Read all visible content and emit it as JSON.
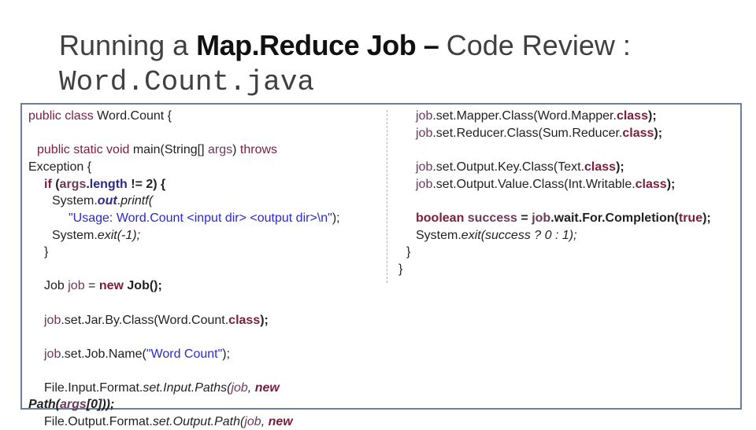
{
  "slide": {
    "title_prefix": "Running a ",
    "title_bold": "Map.Reduce Job",
    "title_dash": " – ",
    "title_suffix": "Code Review :",
    "title_line2": "Word.Count.java"
  },
  "left": {
    "l1_a": "public class ",
    "l1_b": "Word.Count {",
    "l2_a": "public static void ",
    "l2_b": "main(String[] ",
    "l2_c": "args",
    "l2_d": ") ",
    "l2_e": "throws",
    "l3": "Exception {",
    "l4_a": "if ",
    "l4_b": "(",
    "l4_c": "args",
    "l4_d": ".",
    "l4_e": "length",
    "l4_f": " != 2) {",
    "l5_a": "System.",
    "l5_b": "out",
    "l5_c": ".",
    "l5_d": "printf(",
    "l6_a": "\"Usage: Word.Count <input dir> <output dir>\\n\"",
    "l6_b": ");",
    "l7_a": "System.",
    "l7_b": "exit(-1);",
    "l8": "}",
    "l9_a": "Job ",
    "l9_b": "job",
    "l9_c": " = ",
    "l9_d": "new ",
    "l9_e": "Job();",
    "l10_a": "job",
    "l10_b": ".set.Jar.By.Class(Word.Count.",
    "l10_c": "class",
    "l10_d": ");",
    "l11_a": "job",
    "l11_b": ".set.Job.Name(",
    "l11_c": "\"Word Count\"",
    "l11_d": ");",
    "l12_a": "File.Input.Format.",
    "l12_b": "set.Input.Paths(",
    "l12_c": "job",
    "l12_d": ", ",
    "l12_e": "new",
    "l13_a": "Path(",
    "l13_b": "args",
    "l13_c": "[0]));",
    "l14_a": "File.Output.Format.",
    "l14_b": "set.Output.Path(",
    "l14_c": "job",
    "l14_d": ", ",
    "l14_e": "new"
  },
  "right": {
    "r1_a": "job",
    "r1_b": ".set.Mapper.Class(Word.Mapper.",
    "r1_c": "class",
    "r1_d": ");",
    "r2_a": "job",
    "r2_b": ".set.Reducer.Class(Sum.Reducer.",
    "r2_c": "class",
    "r2_d": ");",
    "r3_a": "job",
    "r3_b": ".set.Output.Key.Class(Text.",
    "r3_c": "class",
    "r3_d": ");",
    "r4_a": "job",
    "r4_b": ".set.Output.Value.Class(Int.Writable.",
    "r4_c": "class",
    "r4_d": ");",
    "r5_a": "boolean ",
    "r5_b": "success",
    "r5_c": " = ",
    "r5_d": "job",
    "r5_e": ".wait.For.Completion(",
    "r5_f": "true",
    "r5_g": ");",
    "r6_a": "System.",
    "r6_b": "exit(success ? 0 : 1);",
    "r7": "}",
    "r8": "}"
  }
}
